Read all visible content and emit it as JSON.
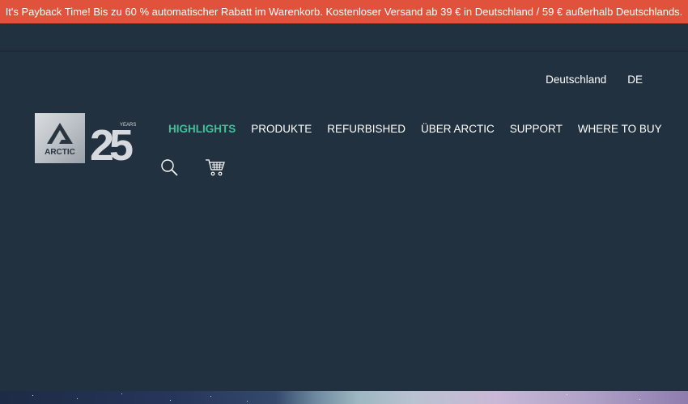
{
  "promo": {
    "text": "It's Payback Time! Bis zu 60 % automatischer Rabatt im Warenkorb. Kostenloser Versand ab 39 € in Deutschland / 59 € außerhalb Deutschlands."
  },
  "header": {
    "country": "Deutschland",
    "language": "DE",
    "logo": {
      "brand": "ARCTIC",
      "anniversary_number": "25",
      "anniversary_word": "YEARS"
    },
    "nav": [
      {
        "label": "HIGHLIGHTS",
        "active": true
      },
      {
        "label": "PRODUKTE",
        "active": false
      },
      {
        "label": "REFURBISHED",
        "active": false
      },
      {
        "label": "ÜBER ARCTIC",
        "active": false
      },
      {
        "label": "SUPPORT",
        "active": false
      },
      {
        "label": "WHERE TO BUY",
        "active": false
      }
    ],
    "icons": [
      "search-icon",
      "cart-icon"
    ]
  },
  "colors": {
    "promo_bg": "#e0523b",
    "header_bg": "#22313f",
    "active_nav": "#3fc29a",
    "text": "#ffffff"
  }
}
